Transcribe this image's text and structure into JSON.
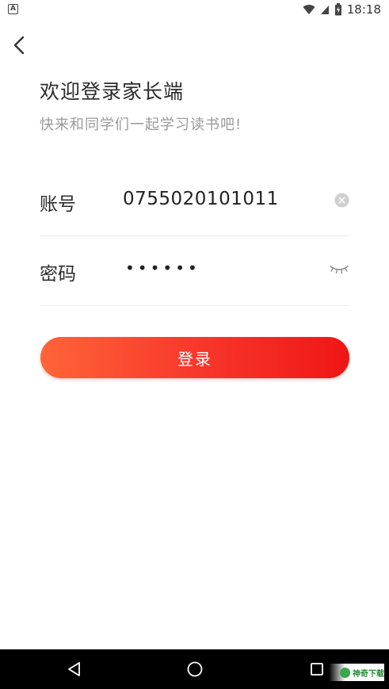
{
  "status_bar": {
    "time": "18:18",
    "left_icon": "A",
    "icons": [
      "wifi-icon",
      "cell-signal-icon",
      "battery-icon"
    ]
  },
  "header": {
    "title": "欢迎登录家长端",
    "subtitle": "快来和同学们一起学习读书吧!"
  },
  "form": {
    "account": {
      "label": "账号",
      "value": "0755020101011"
    },
    "password": {
      "label": "密码",
      "masked_value": "••••••"
    }
  },
  "login_button": {
    "label": "登录"
  },
  "colors": {
    "button_gradient_start": "#ff6438",
    "button_gradient_end": "#ef1616",
    "subtitle": "#9a9a9a",
    "divider": "#ececec"
  },
  "watermark": {
    "text": "神奇下载"
  }
}
